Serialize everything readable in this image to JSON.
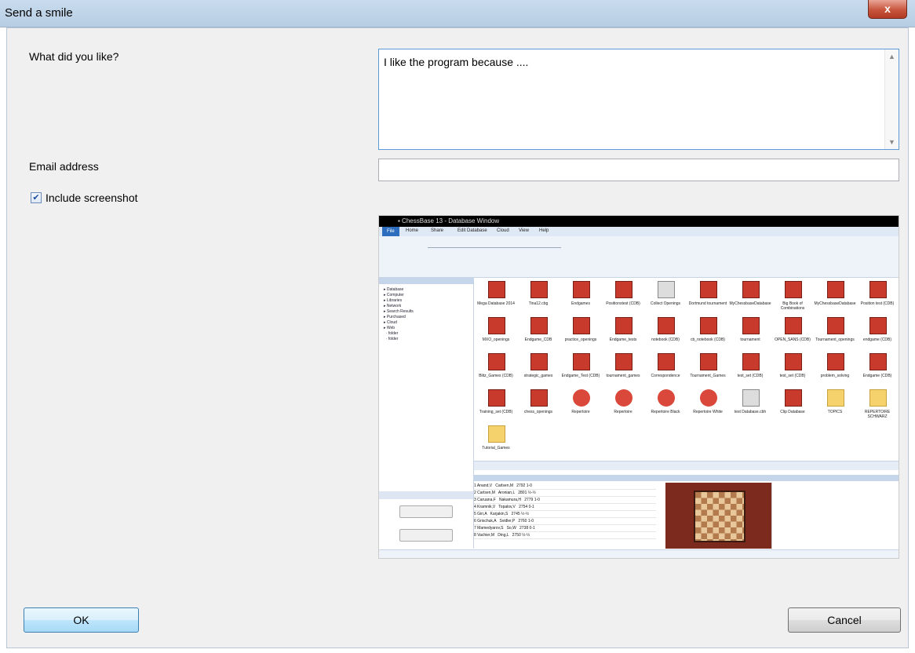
{
  "window": {
    "title": "Send a smile",
    "close_label": "x"
  },
  "form": {
    "what_label": "What did you like?",
    "what_value": "I like the program because ....",
    "email_label": "Email address",
    "email_value": "",
    "include_screenshot_label": "Include screenshot",
    "include_screenshot_checked": true
  },
  "buttons": {
    "ok": "OK",
    "cancel": "Cancel"
  },
  "screenshot": {
    "menu": [
      "File",
      "Home",
      "Share",
      "Edit Database",
      "Cloud",
      "View",
      "Help"
    ],
    "icons": [
      "Mega Database 2014",
      "Tina12.cbg",
      "Endgames",
      "Positionstest (CDB)",
      "Collect Openings",
      "Dortmund tournament",
      "MyChessbaseDatabase",
      "Big Book of Combinations",
      "MyChessbaseDatabase",
      "Position test (CDB)",
      "MXO_openings",
      "Endgame_CDB",
      "practice_openings",
      "Endgame_tests",
      "notebook (CDB)",
      "cb_notebook (CDB)",
      "tournament",
      "OPEN_SANS (CDB)",
      "Tournament_openings",
      "endgame (CDB)",
      "Blitz_Games (CDB)",
      "strategic_games",
      "Endgame_Test (CDB)",
      "tournament_games",
      "Correspondence",
      "Tournament_Games",
      "test_set (CDB)",
      "test_set (CDB)",
      "problem_solving",
      "Endgame (CDB)",
      "Training_set (CDB)",
      "chess_openings",
      "Repertoire",
      "Repertoire",
      "Repertoire Black",
      "Repertoire White",
      "test Database.cbh",
      "Clip Database",
      "TOPICS",
      "REPERTOIRE SCHWARZ",
      "Tutorial_Games"
    ]
  }
}
